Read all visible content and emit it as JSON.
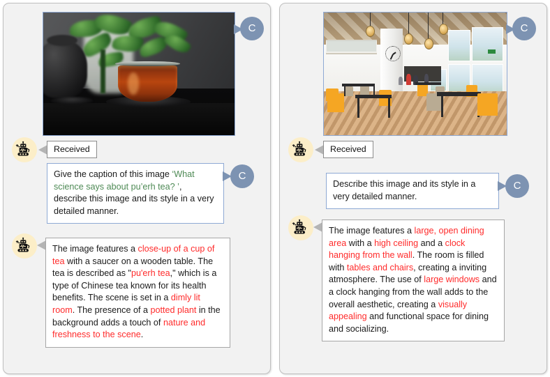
{
  "meta": {
    "layout": "two-panel dialogue comparison",
    "accent_user_border": "#8ea9d4",
    "accent_avatar_user": "#7d93b2",
    "accent_avatar_bot_bg": "#fceec8",
    "highlight_red": "#ff2b2b",
    "highlight_green": "#4e8a55",
    "panel_bg": "#f2f2f2",
    "panel_border": "#bfbfbf"
  },
  "panels": [
    {
      "id": "left",
      "image": {
        "name": "tea-cup-photo",
        "alt": "Close-up of a glass cup of dark amber pu'erh tea on a black saucer, a black teapot at left and a green potted plant blurred in the background on a dark wooden table"
      },
      "user_avatar_label": "C",
      "received_label": "Received",
      "prompt": {
        "segments": [
          {
            "text": "Give the caption of this image ",
            "style": "plain"
          },
          {
            "text": "‘What science says about pu’erh tea? ’",
            "style": "green"
          },
          {
            "text": ", describe this image and its style in a very detailed manner.",
            "style": "plain"
          }
        ]
      },
      "response": {
        "segments": [
          {
            "text": "The image features a ",
            "style": "plain"
          },
          {
            "text": "close-up of a cup of tea",
            "style": "red"
          },
          {
            "text": " with a saucer on a wooden table. The tea is described as \"",
            "style": "plain"
          },
          {
            "text": "pu'erh tea",
            "style": "red"
          },
          {
            "text": ",\" which is a type of Chinese tea known for its health benefits. The scene is set in a ",
            "style": "plain"
          },
          {
            "text": "dimly lit room",
            "style": "red"
          },
          {
            "text": ". The presence of a ",
            "style": "plain"
          },
          {
            "text": "potted plant",
            "style": "red"
          },
          {
            "text": " in the background adds a touch of ",
            "style": "plain"
          },
          {
            "text": "nature and freshness to the scene",
            "style": "red"
          },
          {
            "text": ".",
            "style": "plain"
          }
        ]
      }
    },
    {
      "id": "right",
      "image": {
        "name": "dining-hall-photo",
        "alt": "Large open dining hall with high checkered ceiling, pendant lamps, a wall clock, yellow armchairs, dark tables, large windows and a herringbone wooden floor"
      },
      "user_avatar_label": "C",
      "received_label": "Received",
      "prompt": {
        "segments": [
          {
            "text": "Describe this image and its style in a very detailed manner.",
            "style": "plain"
          }
        ]
      },
      "response": {
        "segments": [
          {
            "text": "The image features a ",
            "style": "plain"
          },
          {
            "text": "large, open dining area",
            "style": "red"
          },
          {
            "text": " with a ",
            "style": "plain"
          },
          {
            "text": "high ceiling",
            "style": "red"
          },
          {
            "text": " and a ",
            "style": "plain"
          },
          {
            "text": "clock hanging from the wall",
            "style": "red"
          },
          {
            "text": ". The room is filled with ",
            "style": "plain"
          },
          {
            "text": "tables and chairs",
            "style": "red"
          },
          {
            "text": ", creating a inviting atmosphere. The use of ",
            "style": "plain"
          },
          {
            "text": "large windows",
            "style": "red"
          },
          {
            "text": " and a clock hanging from the wall adds to the overall aesthetic, creating a ",
            "style": "plain"
          },
          {
            "text": "visually appealing",
            "style": "red"
          },
          {
            "text": " and functional space for dining and socializing.",
            "style": "plain"
          }
        ]
      }
    }
  ]
}
